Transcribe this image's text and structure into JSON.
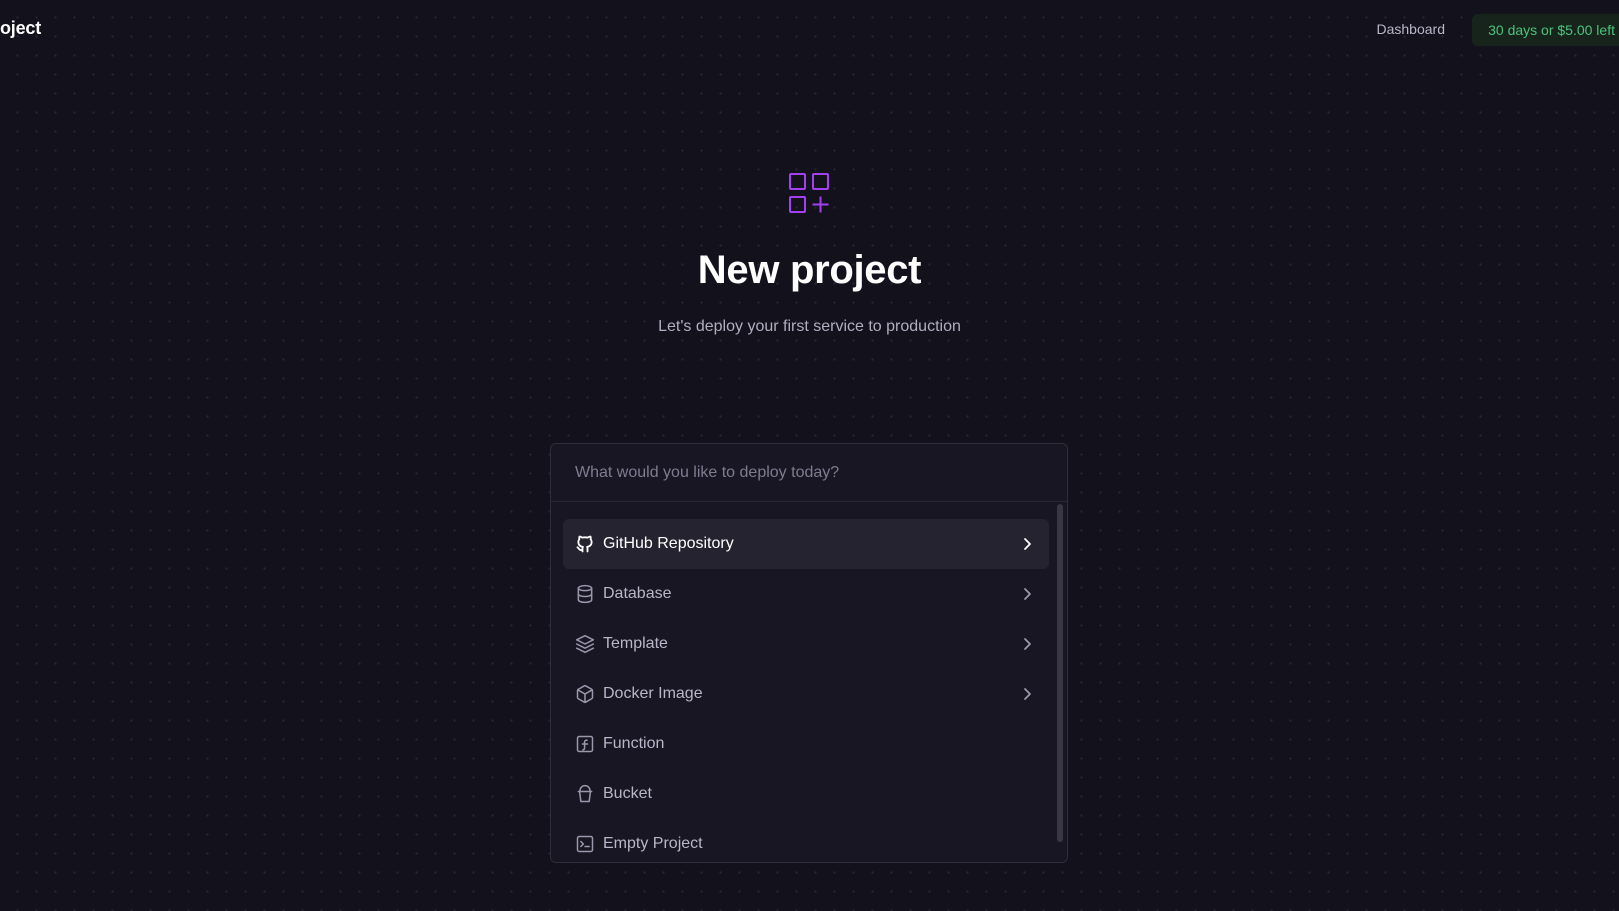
{
  "header": {
    "project_title": "oject",
    "dashboard_label": "Dashboard",
    "trial_badge": "30 days or $5.00 left"
  },
  "hero": {
    "icon": "grid-plus-icon",
    "title": "New project",
    "subtitle": "Let's deploy your first service to production"
  },
  "colors": {
    "background": "#13111c",
    "accent": "#a340f0",
    "badge_text": "#4cc37a",
    "badge_bg": "#16241c"
  },
  "deploy_panel": {
    "search_placeholder": "What would you like to deploy today?",
    "search_value": "",
    "options": [
      {
        "label": "GitHub Repository",
        "icon": "github-icon",
        "has_submenu": true,
        "active": true
      },
      {
        "label": "Database",
        "icon": "database-icon",
        "has_submenu": true,
        "active": false
      },
      {
        "label": "Template",
        "icon": "layers-icon",
        "has_submenu": true,
        "active": false
      },
      {
        "label": "Docker Image",
        "icon": "box-icon",
        "has_submenu": true,
        "active": false
      },
      {
        "label": "Function",
        "icon": "function-icon",
        "has_submenu": false,
        "active": false
      },
      {
        "label": "Bucket",
        "icon": "bucket-icon",
        "has_submenu": false,
        "active": false
      },
      {
        "label": "Empty Project",
        "icon": "terminal-icon",
        "has_submenu": false,
        "active": false
      }
    ]
  }
}
